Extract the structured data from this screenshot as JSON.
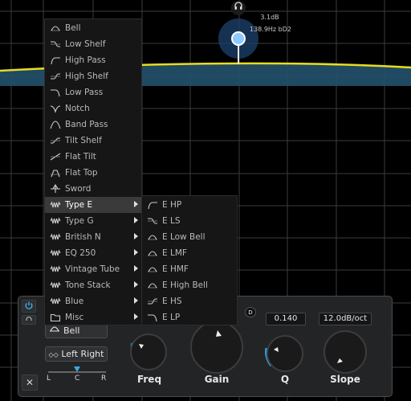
{
  "node_tooltip": {
    "gain": "3.1dB",
    "freq_note": "138.9Hz bD2"
  },
  "filter_menu": {
    "items": [
      {
        "label": "Bell",
        "icon": "bell-shape-icon"
      },
      {
        "label": "Low Shelf",
        "icon": "low-shelf-shape-icon"
      },
      {
        "label": "High Pass",
        "icon": "high-pass-shape-icon"
      },
      {
        "label": "High Shelf",
        "icon": "high-shelf-shape-icon"
      },
      {
        "label": "Low Pass",
        "icon": "low-pass-shape-icon"
      },
      {
        "label": "Notch",
        "icon": "notch-shape-icon"
      },
      {
        "label": "Band Pass",
        "icon": "band-pass-shape-icon"
      },
      {
        "label": "Tilt Shelf",
        "icon": "tilt-shelf-shape-icon"
      },
      {
        "label": "Flat Tilt",
        "icon": "flat-tilt-shape-icon"
      },
      {
        "label": "Flat Top",
        "icon": "flat-top-shape-icon"
      },
      {
        "label": "Sword",
        "icon": "sword-shape-icon"
      },
      {
        "label": "Type E",
        "icon": "analog-wave-icon",
        "submenu": true,
        "highlighted": true
      },
      {
        "label": "Type G",
        "icon": "analog-wave-icon",
        "submenu": true
      },
      {
        "label": "British N",
        "icon": "analog-wave-icon",
        "submenu": true
      },
      {
        "label": "EQ 250",
        "icon": "analog-wave-icon",
        "submenu": true
      },
      {
        "label": "Vintage Tube",
        "icon": "analog-wave-icon",
        "submenu": true
      },
      {
        "label": "Tone Stack",
        "icon": "analog-wave-icon",
        "submenu": true
      },
      {
        "label": "Blue",
        "icon": "analog-wave-icon",
        "submenu": true
      },
      {
        "label": "Misc",
        "icon": "folder-icon",
        "submenu": true
      }
    ]
  },
  "type_e_submenu": {
    "items": [
      {
        "label": "E HP",
        "icon": "high-pass-shape-icon"
      },
      {
        "label": "E LS",
        "icon": "low-shelf-shape-icon"
      },
      {
        "label": "E Low Bell",
        "icon": "bell-shape-icon"
      },
      {
        "label": "E LMF",
        "icon": "bell-shape-icon"
      },
      {
        "label": "E HMF",
        "icon": "bell-shape-icon"
      },
      {
        "label": "E High Bell",
        "icon": "bell-shape-icon"
      },
      {
        "label": "E HS",
        "icon": "high-shelf-shape-icon"
      },
      {
        "label": "E LP",
        "icon": "low-pass-shape-icon"
      }
    ]
  },
  "band_panel": {
    "filter_type": "Bell",
    "stereo_mode": "Left Right",
    "pan": {
      "left": "L",
      "center": "C",
      "right": "R"
    },
    "d_button": "D",
    "q_value": "0.140",
    "slope_value": "12.0dB/oct",
    "knobs": {
      "freq": "Freq",
      "gain": "Gain",
      "q": "Q",
      "slope": "Slope"
    },
    "close": "✕"
  },
  "colors": {
    "curve": "#e8dc1e",
    "fill": "#24516d",
    "grid": "#3b3b3b",
    "node": "#8ec9ff",
    "power_on": "#3aa8e0",
    "knob_arc": "#2aa4e0"
  }
}
